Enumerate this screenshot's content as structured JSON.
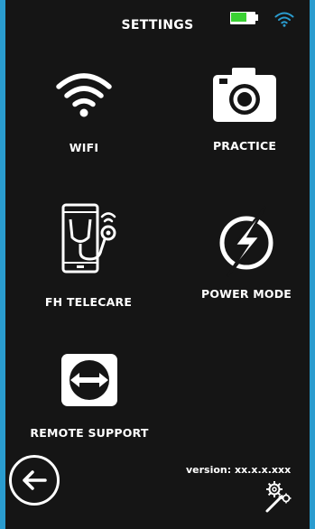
{
  "header": {
    "title": "SETTINGS",
    "battery_level": 0.7
  },
  "tiles": [
    {
      "id": "wifi",
      "label": "WIFI",
      "icon": "wifi-icon"
    },
    {
      "id": "practice",
      "label": "PRACTICE",
      "icon": "camera-icon"
    },
    {
      "id": "telecare",
      "label": "FH TELECARE",
      "icon": "telecare-device-icon"
    },
    {
      "id": "power",
      "label": "POWER MODE",
      "icon": "lightning-icon"
    },
    {
      "id": "remote",
      "label": "REMOTE SUPPORT",
      "icon": "teamviewer-icon"
    }
  ],
  "footer": {
    "version": "version: xx.x.x.xxx"
  },
  "colors": {
    "background": "#151515",
    "frame": "#2a9ccf",
    "battery": "#3ad133",
    "text": "#ffffff"
  }
}
